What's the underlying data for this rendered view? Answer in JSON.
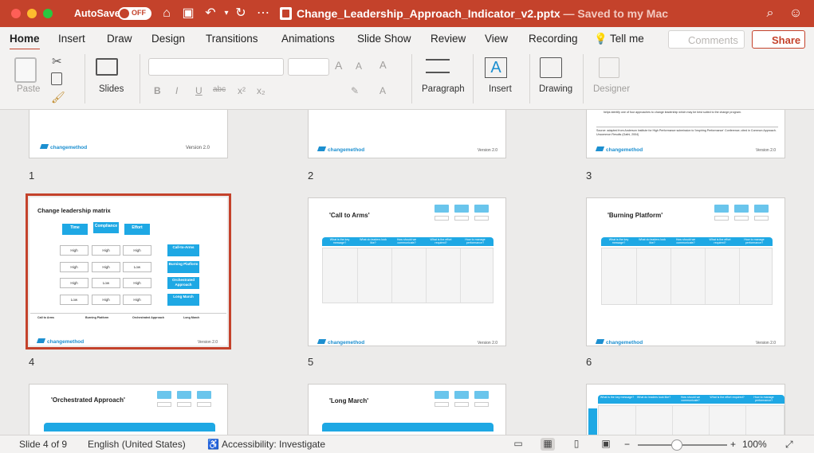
{
  "titlebar": {
    "autosave": "AutoSave",
    "toggle": "OFF",
    "filename": "Change_Leadership_Approach_Indicator_v2.pptx",
    "saved_status": "— Saved to my Mac",
    "accent": "#c4422b"
  },
  "tabs": [
    "Home",
    "Insert",
    "Draw",
    "Design",
    "Transitions",
    "Animations",
    "Slide Show",
    "Review",
    "View",
    "Recording"
  ],
  "tell_me": "Tell me",
  "comments_label": "Comments",
  "share_label": "Share",
  "ribbon": {
    "paste": "Paste",
    "slides": "Slides",
    "paragraph": "Paragraph",
    "insert": "Insert",
    "drawing": "Drawing",
    "designer": "Designer",
    "fmt": [
      "B",
      "I",
      "U",
      "abc",
      "x²",
      "x₂"
    ]
  },
  "slides": {
    "numbers": [
      "1",
      "2",
      "3",
      "4",
      "5",
      "6"
    ],
    "version": "Version 2.0",
    "logo": "changemethod",
    "s3_text": "helps identify one of four approaches to change leadership which may be best suited to the change program.",
    "s3_source": "Source: adapted from Anderson Institute for High Performance submission to 'Inspiring Performance' Conference; cited in Common Approach. Uncommon Results (Gafni, 2004)",
    "s4": {
      "title": "Change leadership matrix",
      "headers": [
        "Time",
        "Compliance",
        "Effort"
      ],
      "rows": [
        [
          "High",
          "High",
          "High",
          "Call-to-Arms"
        ],
        [
          "High",
          "High",
          "Low",
          "Burning Platform"
        ],
        [
          "High",
          "Low",
          "High",
          "Orchestrated Approach"
        ],
        [
          "Low",
          "High",
          "High",
          "Long March"
        ]
      ],
      "bottom": [
        "Call to Arms",
        "Burning Platform",
        "Orchestrated Approach",
        "Long March"
      ]
    },
    "s5_title": "'Call to Arms'",
    "s6_title": "'Burning Platform'",
    "s7_title": "'Orchestrated Approach'",
    "s8_title": "'Long March'",
    "col_headers": [
      "What is the key message?",
      "What do leaders look like?",
      "How should we communicate?",
      "What is the effort required?",
      "How to manage performance?"
    ]
  },
  "status": {
    "slide": "Slide 4 of 9",
    "language": "English (United States)",
    "accessibility": "Accessibility: Investigate",
    "zoom": "100%"
  }
}
